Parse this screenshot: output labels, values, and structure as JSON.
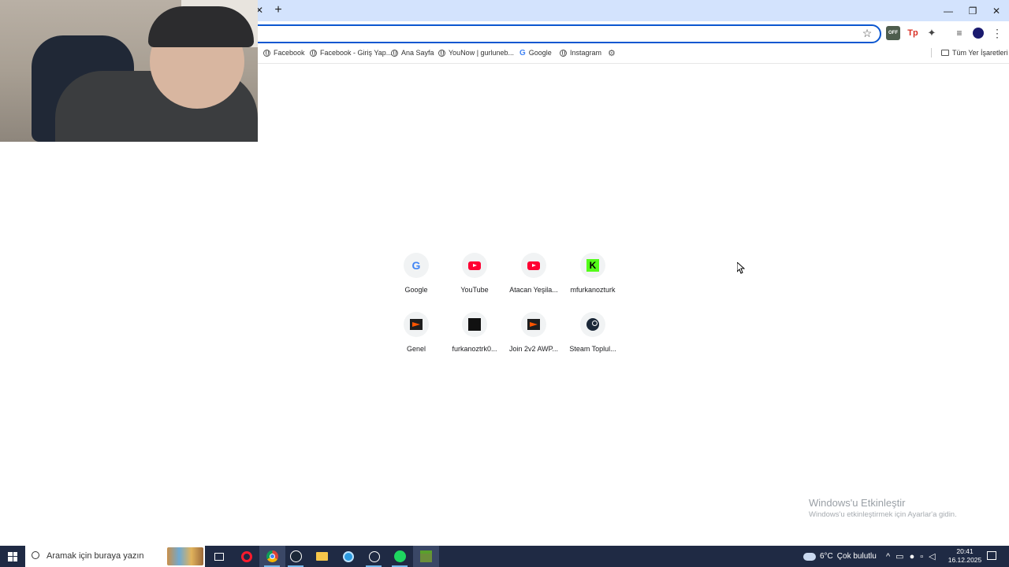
{
  "browser": {
    "tab_close_glyph": "✕",
    "new_tab_glyph": "+",
    "window_controls": {
      "minimize": "—",
      "restore": "❐",
      "close": "✕"
    },
    "star_glyph": "☆",
    "menu_glyph": "⋮",
    "extensions": {
      "off_badge": "OFF",
      "tp_badge": "Tp"
    }
  },
  "bookmarks": {
    "items": [
      {
        "label": "Facebook",
        "icon": "globe-icon"
      },
      {
        "label": "Facebook - Giriş Yap...",
        "icon": "globe-icon"
      },
      {
        "label": "Ana Sayfa",
        "icon": "globe-icon"
      },
      {
        "label": "YouNow | gurluneb...",
        "icon": "globe-icon"
      },
      {
        "label": "Google",
        "icon": "google-icon"
      },
      {
        "label": "Instagram",
        "icon": "globe-icon"
      }
    ],
    "all_bookmarks_label": "Tüm Yer İşaretleri"
  },
  "shortcuts": [
    {
      "label": "Google",
      "icon": "google-icon"
    },
    {
      "label": "YouTube",
      "icon": "youtube-icon"
    },
    {
      "label": "Atacan Yeşila...",
      "icon": "youtube-icon"
    },
    {
      "label": "mfurkanozturk",
      "icon": "kick-icon"
    },
    {
      "label": "Genel",
      "icon": "faceit-icon"
    },
    {
      "label": "furkanoztrk0...",
      "icon": "black-square-icon"
    },
    {
      "label": "Join 2v2 AWP...",
      "icon": "faceit-icon"
    },
    {
      "label": "Steam Toplul...",
      "icon": "steam-icon"
    }
  ],
  "watermark": {
    "title": "Windows'u Etkinleştir",
    "subtitle": "Windows'u etkinleştirmek için Ayarlar'a gidin."
  },
  "taskbar": {
    "search_placeholder": "Aramak için buraya yazın",
    "weather": {
      "temp": "6°C",
      "condition": "Çok bulutlu"
    },
    "time": "20:41",
    "date": "16.12.2025"
  }
}
